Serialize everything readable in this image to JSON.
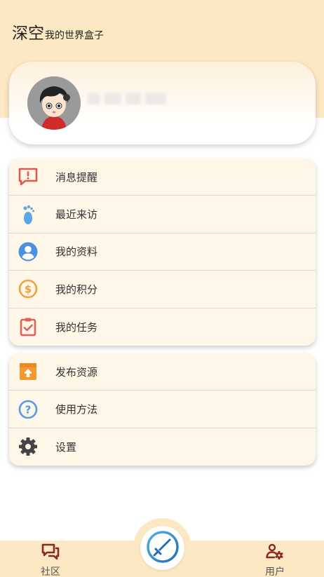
{
  "header": {
    "title": "深空",
    "subtitle": "我的世界盒子"
  },
  "profile": {
    "username": ""
  },
  "menu_group_1": [
    {
      "label": "消息提醒",
      "icon": "message-alert-icon",
      "color": "#e05a4f"
    },
    {
      "label": "最近来访",
      "icon": "footprint-icon",
      "color": "#5aa8e6"
    },
    {
      "label": "我的资料",
      "icon": "user-profile-icon",
      "color": "#4e8fe0"
    },
    {
      "label": "我的积分",
      "icon": "dollar-coin-icon",
      "color": "#f2a13a"
    },
    {
      "label": "我的任务",
      "icon": "clipboard-check-icon",
      "color": "#e0605a"
    }
  ],
  "menu_group_2": [
    {
      "label": "发布资源",
      "icon": "upload-box-icon",
      "color": "#f29a30"
    },
    {
      "label": "使用方法",
      "icon": "help-circle-icon",
      "color": "#4e9be6"
    },
    {
      "label": "设置",
      "icon": "gear-icon",
      "color": "#444444"
    }
  ],
  "bottom_nav": {
    "left_label": "社区",
    "right_label": "用户",
    "left_icon": "chat-bubbles-icon",
    "right_icon": "user-settings-icon",
    "center_icon": "sword-icon"
  },
  "colors": {
    "header_bg": "#fde8c4",
    "card_bg": "#fef6e7",
    "nav_icon": "#8a2a1f"
  }
}
